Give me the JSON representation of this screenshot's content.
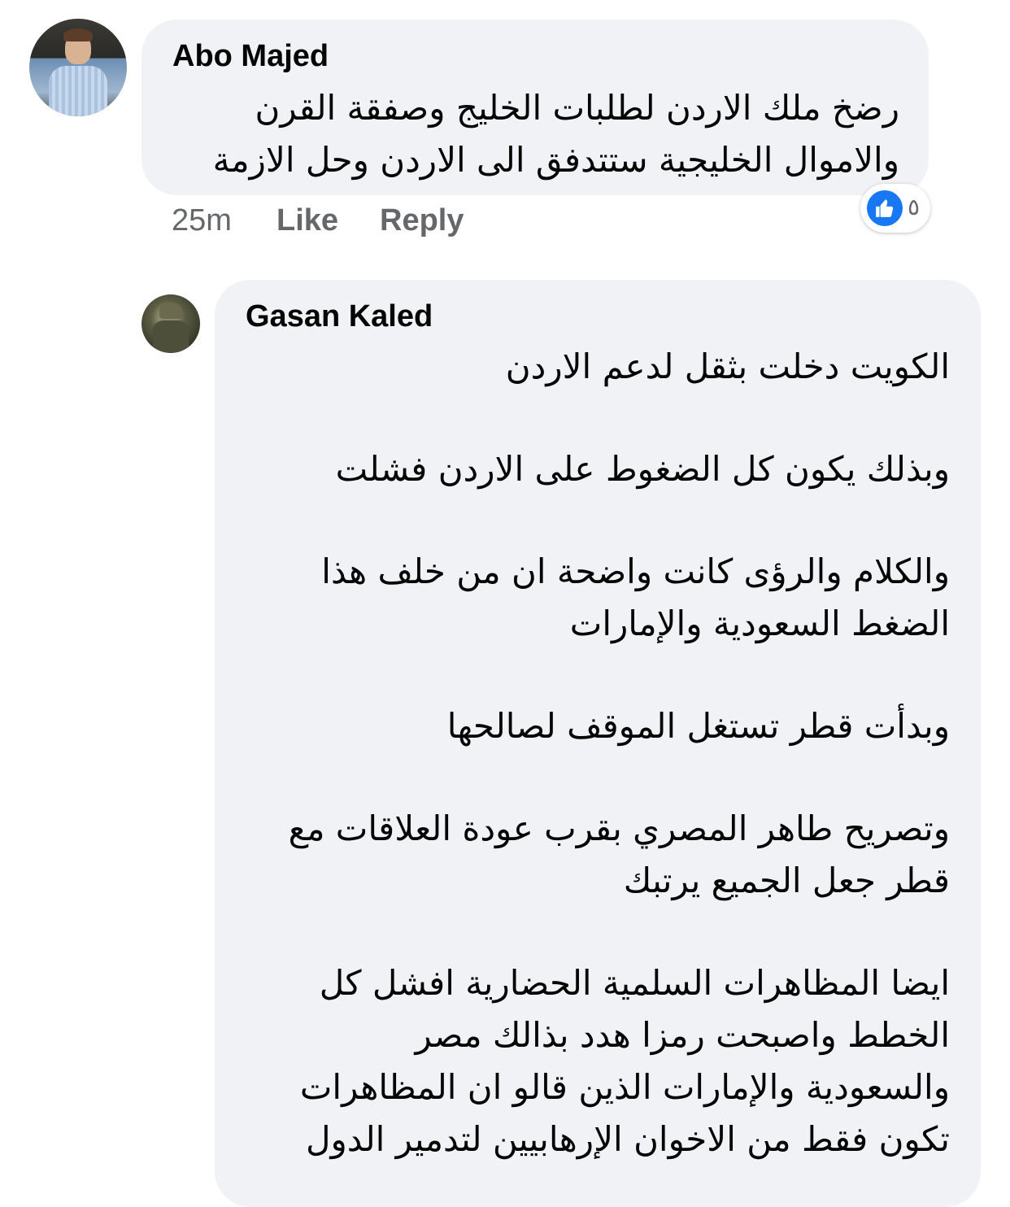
{
  "comments": [
    {
      "author": "Abo Majed",
      "lines": [
        "رضخ ملك الاردن لطلبات الخليج وصفقة القرن",
        "والاموال الخليجية ستتدفق الى الاردن وحل الازمة"
      ],
      "time": "25m",
      "like_label": "Like",
      "reply_label": "Reply",
      "reactions": {
        "icon": "thumbs-up-icon",
        "count": "٥",
        "color": "#1877f2"
      }
    },
    {
      "author": "Gasan Kaled",
      "lines": [
        "الكويت دخلت بثقل لدعم الاردن",
        "وبذلك يكون كل الضغوط على الاردن فشلت",
        "والكلام والرؤى كانت واضحة ان من خلف هذا",
        "الضغط السعودية والإمارات",
        "وبدأت قطر تستغل الموقف لصالحها",
        "وتصريح طاهر المصري بقرب عودة العلاقات مع",
        "قطر جعل الجميع يرتبك",
        "ايضا المظاهرات السلمية الحضارية افشل كل",
        "الخطط واصبحت رمزا هدد بذالك مصر",
        "والسعودية والإمارات الذين قالو ان المظاهرات",
        "تكون فقط من الاخوان الإرهابيين لتدمير الدول"
      ]
    }
  ],
  "colors": {
    "bubble": "#f0f2f5",
    "text": "#050505",
    "meta": "#65676b"
  }
}
